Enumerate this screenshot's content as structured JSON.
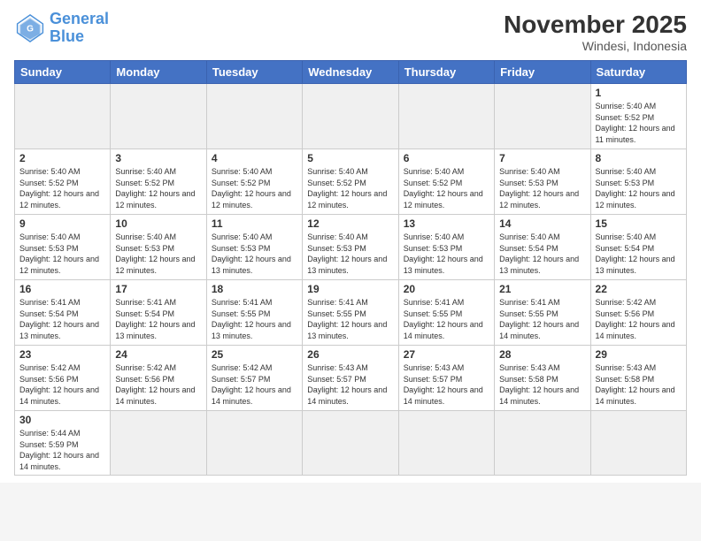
{
  "header": {
    "logo_general": "General",
    "logo_blue": "Blue",
    "month_title": "November 2025",
    "location": "Windesi, Indonesia"
  },
  "weekdays": [
    "Sunday",
    "Monday",
    "Tuesday",
    "Wednesday",
    "Thursday",
    "Friday",
    "Saturday"
  ],
  "days": {
    "1": {
      "sunrise": "5:40 AM",
      "sunset": "5:52 PM",
      "daylight": "12 hours and 11 minutes."
    },
    "2": {
      "sunrise": "5:40 AM",
      "sunset": "5:52 PM",
      "daylight": "12 hours and 12 minutes."
    },
    "3": {
      "sunrise": "5:40 AM",
      "sunset": "5:52 PM",
      "daylight": "12 hours and 12 minutes."
    },
    "4": {
      "sunrise": "5:40 AM",
      "sunset": "5:52 PM",
      "daylight": "12 hours and 12 minutes."
    },
    "5": {
      "sunrise": "5:40 AM",
      "sunset": "5:52 PM",
      "daylight": "12 hours and 12 minutes."
    },
    "6": {
      "sunrise": "5:40 AM",
      "sunset": "5:52 PM",
      "daylight": "12 hours and 12 minutes."
    },
    "7": {
      "sunrise": "5:40 AM",
      "sunset": "5:53 PM",
      "daylight": "12 hours and 12 minutes."
    },
    "8": {
      "sunrise": "5:40 AM",
      "sunset": "5:53 PM",
      "daylight": "12 hours and 12 minutes."
    },
    "9": {
      "sunrise": "5:40 AM",
      "sunset": "5:53 PM",
      "daylight": "12 hours and 12 minutes."
    },
    "10": {
      "sunrise": "5:40 AM",
      "sunset": "5:53 PM",
      "daylight": "12 hours and 12 minutes."
    },
    "11": {
      "sunrise": "5:40 AM",
      "sunset": "5:53 PM",
      "daylight": "12 hours and 13 minutes."
    },
    "12": {
      "sunrise": "5:40 AM",
      "sunset": "5:53 PM",
      "daylight": "12 hours and 13 minutes."
    },
    "13": {
      "sunrise": "5:40 AM",
      "sunset": "5:53 PM",
      "daylight": "12 hours and 13 minutes."
    },
    "14": {
      "sunrise": "5:40 AM",
      "sunset": "5:54 PM",
      "daylight": "12 hours and 13 minutes."
    },
    "15": {
      "sunrise": "5:40 AM",
      "sunset": "5:54 PM",
      "daylight": "12 hours and 13 minutes."
    },
    "16": {
      "sunrise": "5:41 AM",
      "sunset": "5:54 PM",
      "daylight": "12 hours and 13 minutes."
    },
    "17": {
      "sunrise": "5:41 AM",
      "sunset": "5:54 PM",
      "daylight": "12 hours and 13 minutes."
    },
    "18": {
      "sunrise": "5:41 AM",
      "sunset": "5:55 PM",
      "daylight": "12 hours and 13 minutes."
    },
    "19": {
      "sunrise": "5:41 AM",
      "sunset": "5:55 PM",
      "daylight": "12 hours and 13 minutes."
    },
    "20": {
      "sunrise": "5:41 AM",
      "sunset": "5:55 PM",
      "daylight": "12 hours and 14 minutes."
    },
    "21": {
      "sunrise": "5:41 AM",
      "sunset": "5:55 PM",
      "daylight": "12 hours and 14 minutes."
    },
    "22": {
      "sunrise": "5:42 AM",
      "sunset": "5:56 PM",
      "daylight": "12 hours and 14 minutes."
    },
    "23": {
      "sunrise": "5:42 AM",
      "sunset": "5:56 PM",
      "daylight": "12 hours and 14 minutes."
    },
    "24": {
      "sunrise": "5:42 AM",
      "sunset": "5:56 PM",
      "daylight": "12 hours and 14 minutes."
    },
    "25": {
      "sunrise": "5:42 AM",
      "sunset": "5:57 PM",
      "daylight": "12 hours and 14 minutes."
    },
    "26": {
      "sunrise": "5:43 AM",
      "sunset": "5:57 PM",
      "daylight": "12 hours and 14 minutes."
    },
    "27": {
      "sunrise": "5:43 AM",
      "sunset": "5:57 PM",
      "daylight": "12 hours and 14 minutes."
    },
    "28": {
      "sunrise": "5:43 AM",
      "sunset": "5:58 PM",
      "daylight": "12 hours and 14 minutes."
    },
    "29": {
      "sunrise": "5:43 AM",
      "sunset": "5:58 PM",
      "daylight": "12 hours and 14 minutes."
    },
    "30": {
      "sunrise": "5:44 AM",
      "sunset": "5:59 PM",
      "daylight": "12 hours and 14 minutes."
    }
  }
}
